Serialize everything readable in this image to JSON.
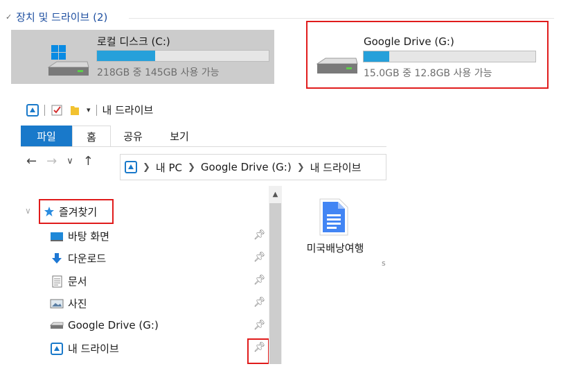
{
  "devices_section": {
    "title": "장치 및 드라이브 (2)",
    "drives": [
      {
        "name": "로컬 디스크 (C:)",
        "free_text": "218GB 중 145GB 사용 가능",
        "used_fraction": 0.34
      },
      {
        "name": "Google Drive (G:)",
        "free_text": "15.0GB 중 12.8GB 사용 가능",
        "used_fraction": 0.15
      }
    ]
  },
  "explorer": {
    "title": "내 드라이브",
    "ribbon_tabs": [
      "파일",
      "홈",
      "공유",
      "보기"
    ],
    "breadcrumb": [
      "내 PC",
      "Google Drive (G:)",
      "내 드라이브"
    ],
    "nav_pane": {
      "favorites_label": "즐겨찾기",
      "items": [
        {
          "label": "바탕 화면",
          "icon": "desktop-icon"
        },
        {
          "label": "다운로드",
          "icon": "download-icon"
        },
        {
          "label": "문서",
          "icon": "documents-icon"
        },
        {
          "label": "사진",
          "icon": "pictures-icon"
        },
        {
          "label": "Google Drive (G:)",
          "icon": "drive-icon"
        },
        {
          "label": "내 드라이브",
          "icon": "google-drive-icon"
        }
      ]
    },
    "files": [
      {
        "name": "미국배낭여행",
        "icon": "google-doc-icon"
      }
    ]
  },
  "colors": {
    "accent": "#1979ca",
    "bar_fill": "#26a0da",
    "highlight": "#e01b1b",
    "selected_bg": "#cccccc"
  }
}
